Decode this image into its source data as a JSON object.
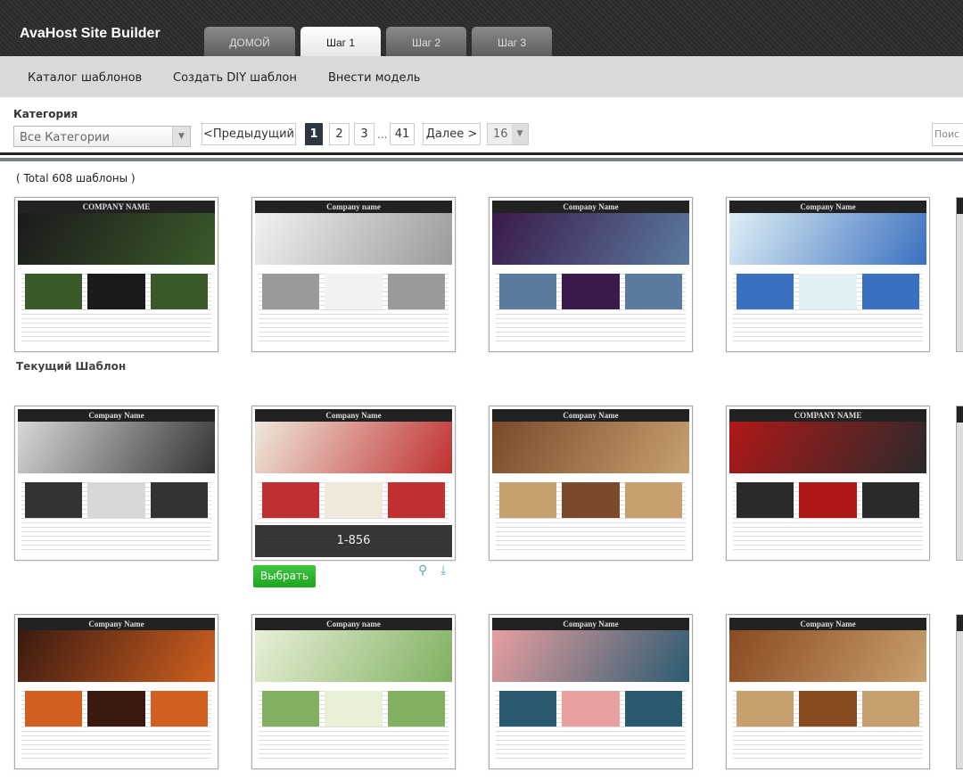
{
  "header": {
    "logo": "AvaHost Site Builder",
    "tabs": [
      {
        "label": "ДОМОЙ",
        "active": false
      },
      {
        "label": "Шаг 1",
        "active": true
      },
      {
        "label": "Шаг 2",
        "active": false
      },
      {
        "label": "Шаг 3",
        "active": false
      }
    ]
  },
  "subnav": {
    "items": [
      "Каталог шаблонов",
      "Создать DIY шаблон",
      "Внести модель"
    ]
  },
  "filter": {
    "category_label": "Категория",
    "category_value": "Все Категории",
    "prev": "<Предыдущий",
    "pages": [
      "1",
      "2",
      "3",
      "41"
    ],
    "ellipsis": "...",
    "current_page": "1",
    "next": "Далее >",
    "per_page": "16",
    "search_placeholder": "Поис"
  },
  "total": "( Total 608 шаблоны )",
  "current_template_label": "Текущий Шаблон",
  "hovered": {
    "id": "1-856",
    "select_label": "Выбрать",
    "zoom_icon": "magnifier-icon",
    "download_icon": "download-icon"
  },
  "templates": [
    {
      "title": "COMPANY NAME",
      "colors": [
        "#1a1a1a",
        "#3a5a2a"
      ]
    },
    {
      "title": "Company name",
      "colors": [
        "#f2f2f2",
        "#9a9a9a"
      ]
    },
    {
      "title": "Company Name",
      "colors": [
        "#3a1a4a",
        "#5a7aa0"
      ]
    },
    {
      "title": "Company Name",
      "colors": [
        "#e0f0f5",
        "#3a70c0"
      ]
    },
    {
      "title": "Company Name",
      "colors": [
        "#d8d8d8",
        "#333333"
      ]
    },
    {
      "title": "Company Name",
      "colors": [
        "#efe9dc",
        "#c03030"
      ]
    },
    {
      "title": "Company Name",
      "colors": [
        "#7a4a2a",
        "#c8a070"
      ]
    },
    {
      "title": "COMPANY NAME",
      "colors": [
        "#b01818",
        "#2a2a2a"
      ]
    },
    {
      "title": "Company Name",
      "colors": [
        "#3a1a10",
        "#d06020"
      ]
    },
    {
      "title": "Company name",
      "colors": [
        "#e8f0d8",
        "#80b060"
      ]
    },
    {
      "title": "Company Name",
      "colors": [
        "#e8a0a0",
        "#2a5a70"
      ]
    },
    {
      "title": "Company Name",
      "colors": [
        "#8a4a20",
        "#c8a070"
      ]
    }
  ]
}
